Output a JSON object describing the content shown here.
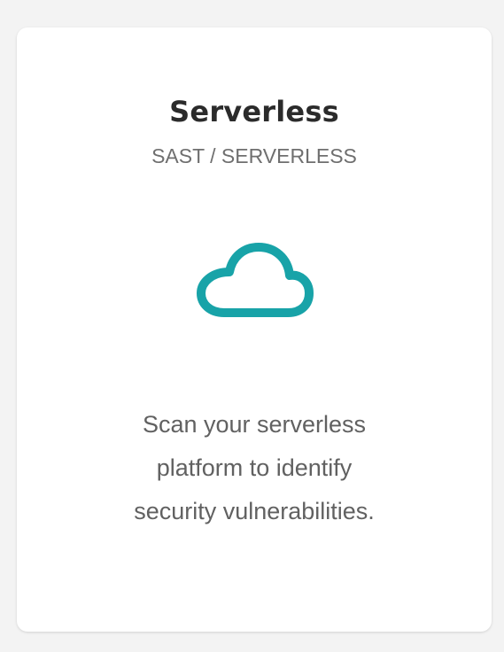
{
  "card": {
    "title": "Serverless",
    "subtitle": "SAST / SERVERLESS",
    "icon": "cloud-icon",
    "description": "Scan your serverless platform to identify security vulnerabilities."
  },
  "colors": {
    "accent": "#18a3a8",
    "background": "#f3f3f3",
    "card": "#ffffff"
  }
}
